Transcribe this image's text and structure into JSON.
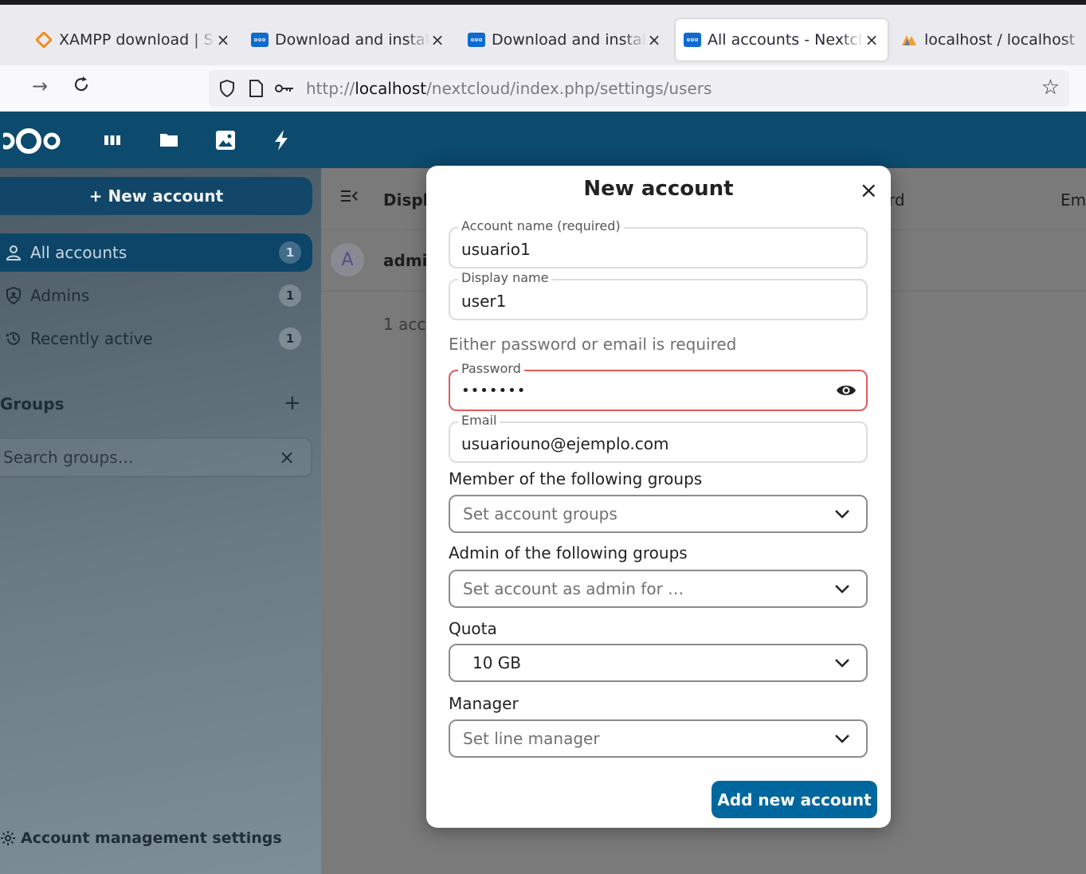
{
  "browser": {
    "tabs": [
      {
        "title": "XAMPP download | S",
        "active": false
      },
      {
        "title": "Download and instal",
        "active": false
      },
      {
        "title": "Download and instal",
        "active": false
      },
      {
        "title": "All accounts - Nextcl",
        "active": true
      },
      {
        "title": "localhost / localhost",
        "active": false
      }
    ],
    "tab_close": "×",
    "url_host": "localhost",
    "url_prefix": "http://",
    "url_path": "/nextcloud/index.php/settings/users"
  },
  "sidebar": {
    "new_account_label": "+ New account",
    "items": [
      {
        "label": "All accounts",
        "count": "1"
      },
      {
        "label": "Admins",
        "count": "1"
      },
      {
        "label": "Recently active",
        "count": "1"
      }
    ],
    "groups_heading": "Groups",
    "groups_add": "+",
    "search_groups_placeholder": "Search groups…",
    "search_clear": "×",
    "account_settings_label": "Account management settings"
  },
  "main": {
    "col_display": "Displ",
    "col_password": "rd",
    "col_email": "Em",
    "row_avatar_letter": "A",
    "row_name": "admi",
    "footer_count": "1 acc"
  },
  "modal": {
    "title": "New account",
    "close": "×",
    "account_name_label": "Account name (required)",
    "account_name_value": "usuario1",
    "display_name_label": "Display name",
    "display_name_value": "user1",
    "hint": "Either password or email is required",
    "password_label": "Password",
    "password_value": "•••••••",
    "email_label": "Email",
    "email_value": "usuariouno@ejemplo.com",
    "groups_label": "Member of the following groups",
    "groups_placeholder": "Set account groups",
    "admin_label": "Admin of the following groups",
    "admin_placeholder": "Set account as admin for …",
    "quota_label": "Quota",
    "quota_value": "10 GB",
    "manager_label": "Manager",
    "manager_placeholder": "Set line manager",
    "submit_label": "Add new account"
  },
  "colors": {
    "header": "#0c4a6e",
    "primary_button": "#00679e",
    "error_border": "#e15b5b"
  }
}
